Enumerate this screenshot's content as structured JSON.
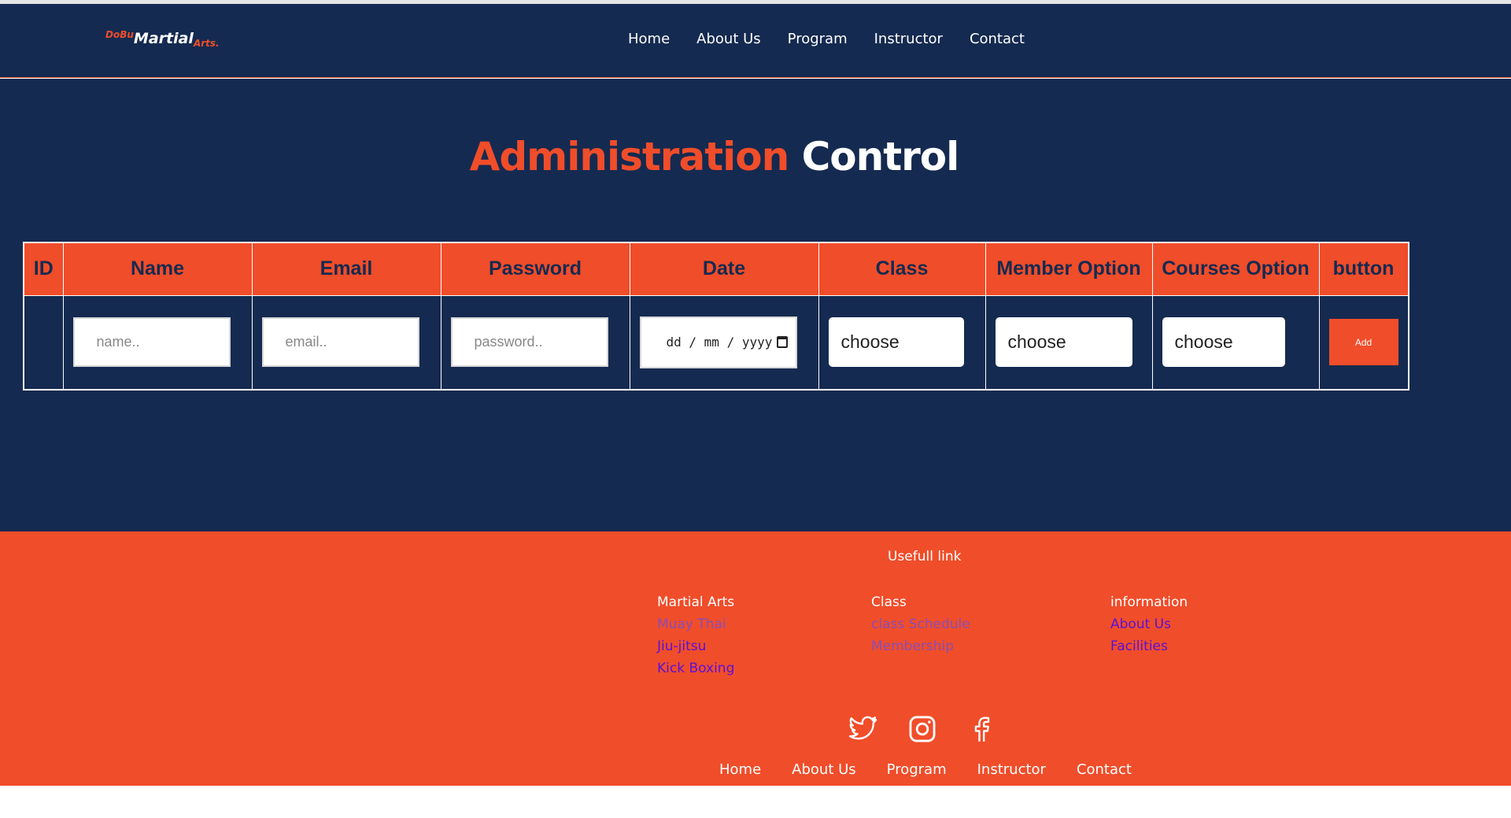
{
  "header": {
    "logo_pre": "DoBu",
    "logo_main": "Martial",
    "logo_suf": "Arts.",
    "nav": [
      "Home",
      "About Us",
      "Program",
      "Instructor",
      "Contact"
    ]
  },
  "main": {
    "title_accent": "Administration",
    "title_rest": "Control",
    "table": {
      "headers": [
        "ID",
        "Name",
        "Email",
        "Password",
        "Date",
        "Class",
        "Member Option",
        "Courses Option",
        "button"
      ],
      "name_placeholder": "name..",
      "email_placeholder": "email..",
      "password_placeholder": "password..",
      "date_placeholder": "dd / mm / yyyy",
      "class_value": "choose",
      "member_value": "choose",
      "courses_value": "choose",
      "add_label": "Add"
    }
  },
  "footer": {
    "heading": "Usefull link",
    "col1": {
      "title": "Martial Arts",
      "links": [
        "Muay Thai",
        "Jiu-jitsu",
        "Kick Boxing"
      ]
    },
    "col2": {
      "title": "Class",
      "links": [
        "class Schedule",
        "Membership"
      ]
    },
    "col3": {
      "title": "information",
      "links": [
        "About Us",
        "Facilities"
      ]
    },
    "social": [
      "twitter-icon",
      "instagram-icon",
      "facebook-icon"
    ],
    "nav": [
      "Home",
      "About Us",
      "Program",
      "Instructor",
      "Contact"
    ]
  },
  "colors": {
    "navy": "#152a50",
    "orange": "#f04d2a",
    "link": "#5a11d8"
  }
}
